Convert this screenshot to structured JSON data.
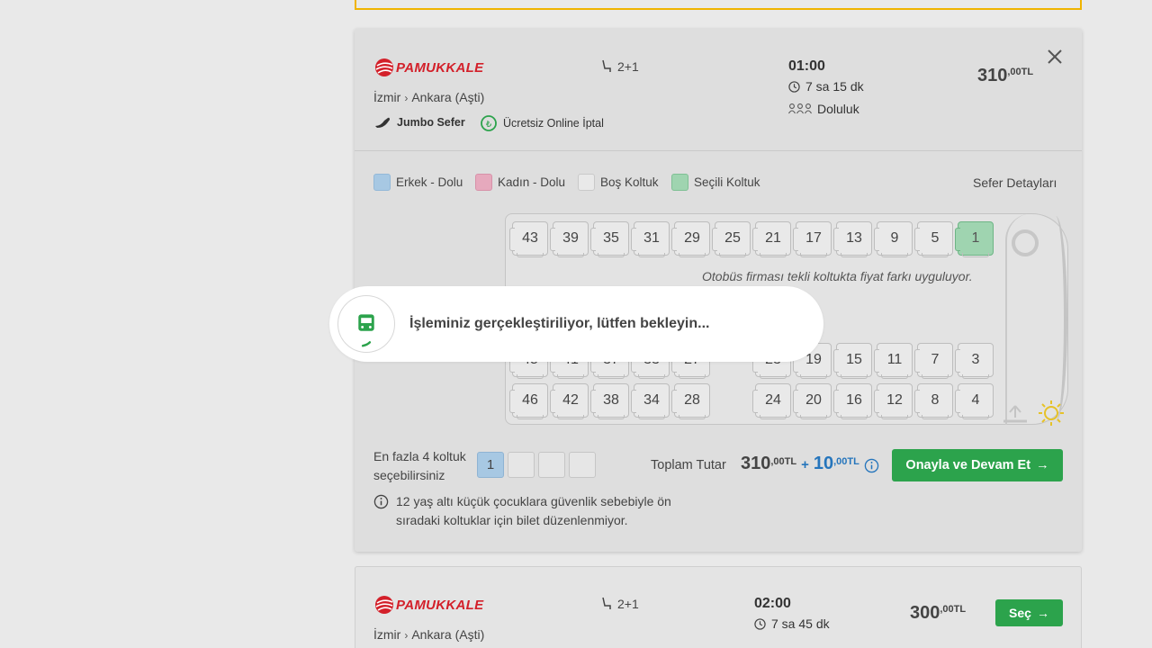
{
  "trip1": {
    "company": "PAMUKKALE",
    "from": "İzmir",
    "to": "Ankara (Aşti)",
    "tag_jumbo": "Jumbo Sefer",
    "tag_cancel": "Ücretsiz Online İptal",
    "seat_layout": "2+1",
    "departure": "01:00",
    "duration": "7 sa 15 dk",
    "occupancy": "Doluluk",
    "price_int": "310",
    "price_dec": ",00TL"
  },
  "legend": {
    "male": "Erkek - Dolu",
    "female": "Kadın - Dolu",
    "empty": "Boş Koltuk",
    "selected": "Seçili Koltuk",
    "colors": {
      "male": "#a7c8e3",
      "female": "#e6a9bd",
      "empty": "#e9e9e9",
      "selected": "#9fd4b0"
    }
  },
  "sefer_detaylari": "Sefer Detayları",
  "seats": {
    "row1": [
      "43",
      "39",
      "35",
      "31",
      "29",
      "25",
      "21",
      "17",
      "13",
      "9",
      "5",
      "1"
    ],
    "row3": [
      "45",
      "41",
      "37",
      "33",
      "27",
      "23",
      "19",
      "15",
      "11",
      "7",
      "3"
    ],
    "row4": [
      "46",
      "42",
      "38",
      "34",
      "28",
      "24",
      "20",
      "16",
      "12",
      "8",
      "4"
    ],
    "selected": "1"
  },
  "note": "Otobüs firması tekli koltukta fiyat farkı uyguluyor.",
  "modal": {
    "text": "İşleminiz gerçekleştiriliyor, lütfen bekleyin..."
  },
  "selection": {
    "max_label": "En fazla 4 koltuk seçebilirsiniz",
    "slots": [
      "1",
      "",
      "",
      ""
    ]
  },
  "total": {
    "label": "Toplam Tutar",
    "price_int": "310",
    "price_dec": ",00TL",
    "plus": "+",
    "fee_int": "10",
    "fee_dec": ",00TL"
  },
  "confirm_label": "Onayla ve Devam Et",
  "warning": "12 yaş altı küçük çocuklara güvenlik sebebiyle ön sıradaki koltuklar için bilet düzenlenmiyor.",
  "trip2": {
    "company": "PAMUKKALE",
    "from": "İzmir",
    "to": "Ankara (Aşti)",
    "seat_layout": "2+1",
    "departure": "02:00",
    "duration": "7 sa 45 dk",
    "price_int": "300",
    "price_dec": ",00TL",
    "select_label": "Seç"
  }
}
